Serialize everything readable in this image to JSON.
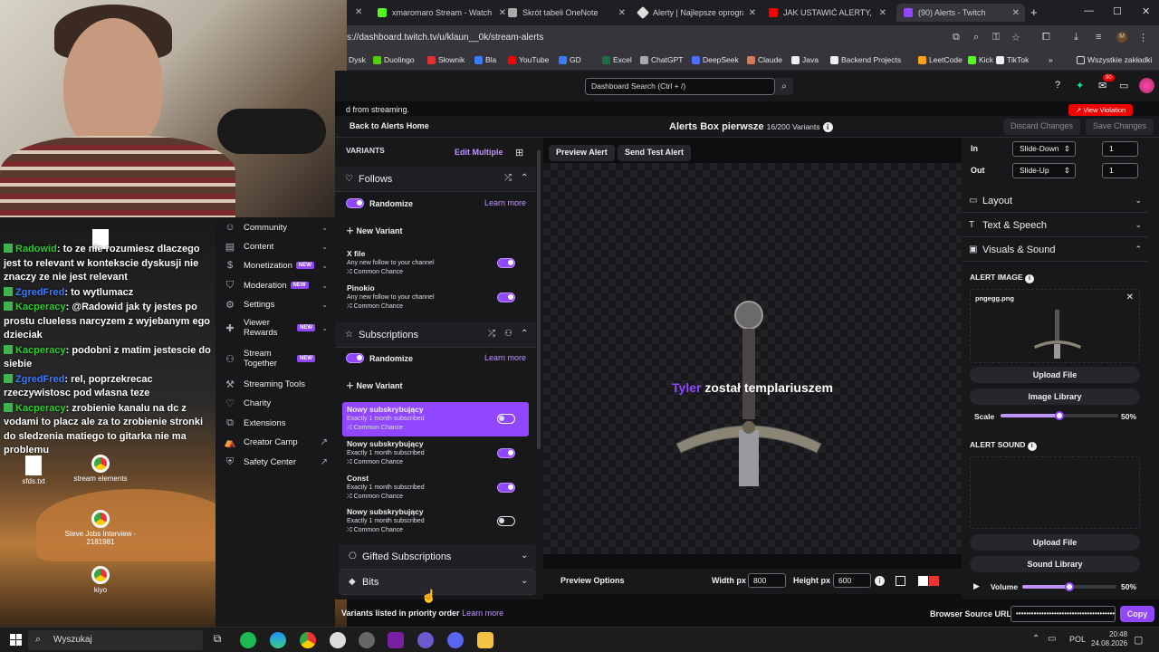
{
  "tabs": [
    {
      "label": "xmaromaro Stream - Watch"
    },
    {
      "label": "Skrót tabeli OneNote"
    },
    {
      "label": "Alerty | Najlepsze oprogramowanie"
    },
    {
      "label": "JAK USTAWIĆ ALERTY, CHAT"
    },
    {
      "label": "(90) Alerts - Twitch"
    }
  ],
  "url": "s://dashboard.twitch.tv/u/klaun__0k/stream-alerts",
  "bookmarks": [
    {
      "label": "Dysk",
      "color": "#3a7bff"
    },
    {
      "label": "Duolingo",
      "color": "#58cc02"
    },
    {
      "label": "Słownik",
      "color": "#d33"
    },
    {
      "label": "Bla",
      "color": "#3a7bff"
    },
    {
      "label": "YouTube",
      "color": "#f00"
    },
    {
      "label": "GD",
      "color": "#3a7bff"
    },
    {
      "label": "Excel",
      "color": "#1d6f42"
    },
    {
      "label": "ChatGPT",
      "color": "#aaa"
    },
    {
      "label": "DeepSeek",
      "color": "#4d6bfe"
    },
    {
      "label": "Claude",
      "color": "#d97757"
    },
    {
      "label": "Java",
      "color": "#fff"
    },
    {
      "label": "Backend Projects",
      "color": "#fff"
    },
    {
      "label": "LeetCode",
      "color": "#ffa116"
    },
    {
      "label": "Kick",
      "color": "#53fc18"
    },
    {
      "label": "TikTok",
      "color": "#fff"
    },
    {
      "label": "Wszystkie zakładki",
      "color": "#ddd"
    }
  ],
  "header": {
    "search_placeholder": "Dashboard Search (Ctrl + /)",
    "notif_count": "90"
  },
  "banner": {
    "text": "d from streaming.",
    "violation": "View Violation"
  },
  "alertbar": {
    "back": "Back to Alerts Home",
    "title": "Alerts Box pierwsze",
    "variants": "16/200 Variants",
    "discard": "Discard Changes",
    "save": "Save Changes"
  },
  "leftnav": [
    {
      "label": "Community",
      "badge": "",
      "chev": true
    },
    {
      "label": "Content",
      "badge": "",
      "chev": true
    },
    {
      "label": "Monetization",
      "badge": "NEW",
      "chev": true
    },
    {
      "label": "Moderation",
      "badge": "NEW",
      "chev": true
    },
    {
      "label": "Settings",
      "badge": "",
      "chev": true
    },
    {
      "label": "Viewer Rewards",
      "badge": "NEW",
      "chev": true
    },
    {
      "label": "Stream Together",
      "badge": "NEW",
      "chev": false
    },
    {
      "label": "Streaming Tools",
      "badge": "",
      "chev": false
    },
    {
      "label": "Charity",
      "badge": "",
      "chev": false
    },
    {
      "label": "Extensions",
      "badge": "",
      "chev": false
    },
    {
      "label": "Creator Camp",
      "badge": "",
      "ext": true
    },
    {
      "label": "Safety Center",
      "badge": "",
      "ext": true
    }
  ],
  "chat": [
    {
      "user": "Radowid",
      "text": "to ze nie rozumiesz dlaczego jest to relevant w kontekscie dyskusji nie znaczy ze nie jest relevant",
      "ucolor": "#2ecc2e"
    },
    {
      "user": "ZgredFred",
      "text": "to wytlumacz",
      "ucolor": "#3a7bff"
    },
    {
      "user": "Kacperacy",
      "text": "@Radowid jak ty jestes po prostu clueless narcyzem z wyjebanym ego dzieciak",
      "ucolor": "#2ecc2e"
    },
    {
      "user": "Kacperacy",
      "text": "podobni z matim jestescie do siebie",
      "ucolor": "#2ecc2e"
    },
    {
      "user": "ZgredFred",
      "text": "rel, poprzekrecac rzeczywistosc pod wlasna teze",
      "ucolor": "#3a7bff"
    },
    {
      "user": "Kacperacy",
      "text": "zrobienie kanalu na dc z vodami to placz ale za to zrobienie stronki do sledzenia matiego to gitarka nie ma problemu",
      "ucolor": "#2ecc2e"
    }
  ],
  "desktop_icons": [
    {
      "label": "sfds.txt"
    },
    {
      "label": "stream elements"
    },
    {
      "label": "Steve Jobs Interview - 2181981"
    },
    {
      "label": "kiyo"
    }
  ],
  "variants": {
    "heading": "VARIANTS",
    "edit_multiple": "Edit Multiple",
    "randomize": "Randomize",
    "learn_more": "Learn more",
    "new_variant": "New Variant",
    "sections": [
      {
        "label": "Follows"
      },
      {
        "label": "Subscriptions"
      },
      {
        "label": "Gifted Subscriptions"
      },
      {
        "label": "Bits"
      }
    ],
    "follows": [
      {
        "name": "X file",
        "desc": "Any new follow to your channel",
        "chance": "Common Chance",
        "on": true
      },
      {
        "name": "Pinokio",
        "desc": "Any new follow to your channel",
        "chance": "Common Chance",
        "on": true
      }
    ],
    "subs": [
      {
        "name": "Nowy subskrybujący",
        "desc": "Exactly 1 month subscribed",
        "chance": "Common Chance",
        "on": false,
        "selected": true
      },
      {
        "name": "Nowy subskrybujący",
        "desc": "Exactly 1 month subscribed",
        "chance": "Common Chance",
        "on": true
      },
      {
        "name": "Const",
        "desc": "Exactly 1 month subscribed",
        "chance": "Common Chance",
        "on": true
      },
      {
        "name": "Nowy subskrybujący",
        "desc": "Exactly 1 month subscribed",
        "chance": "Common Chance",
        "on": false
      }
    ],
    "priority": "Variants listed in priority order"
  },
  "preview": {
    "preview_btn": "Preview Alert",
    "test_btn": "Send Test Alert",
    "alert_name": "Tyler",
    "alert_text": "został templariuszem",
    "options_label": "Preview Options",
    "width_label": "Width px",
    "width": "800",
    "height_label": "Height px",
    "height": "600"
  },
  "right": {
    "in_label": "In",
    "in_anim": "Slide-Down",
    "in_val": "1",
    "out_label": "Out",
    "out_anim": "Slide-Up",
    "out_val": "1",
    "layout": "Layout",
    "text_speech": "Text & Speech",
    "visuals": "Visuals & Sound",
    "alert_image": "ALERT IMAGE",
    "image_file": "pngegg.png",
    "upload_file": "Upload File",
    "image_library": "Image Library",
    "scale_label": "Scale",
    "scale": "50%",
    "scale_frac": 0.5,
    "alert_sound": "ALERT SOUND",
    "sound_library": "Sound Library",
    "volume_label": "Volume",
    "volume": "50%",
    "volume_frac": 0.5,
    "browser_source": "Browser Source URL",
    "source_mask": "••••••••••••••••••••••••••••••••••••••••",
    "copy": "Copy"
  },
  "taskbar": {
    "search": "Wyszukaj",
    "lang": "POL",
    "time": "20:48",
    "date": "24.08.2026"
  },
  "colors": {
    "accent": "#9147ff",
    "accent_light": "#bf94ff",
    "bg": "#18181b"
  }
}
